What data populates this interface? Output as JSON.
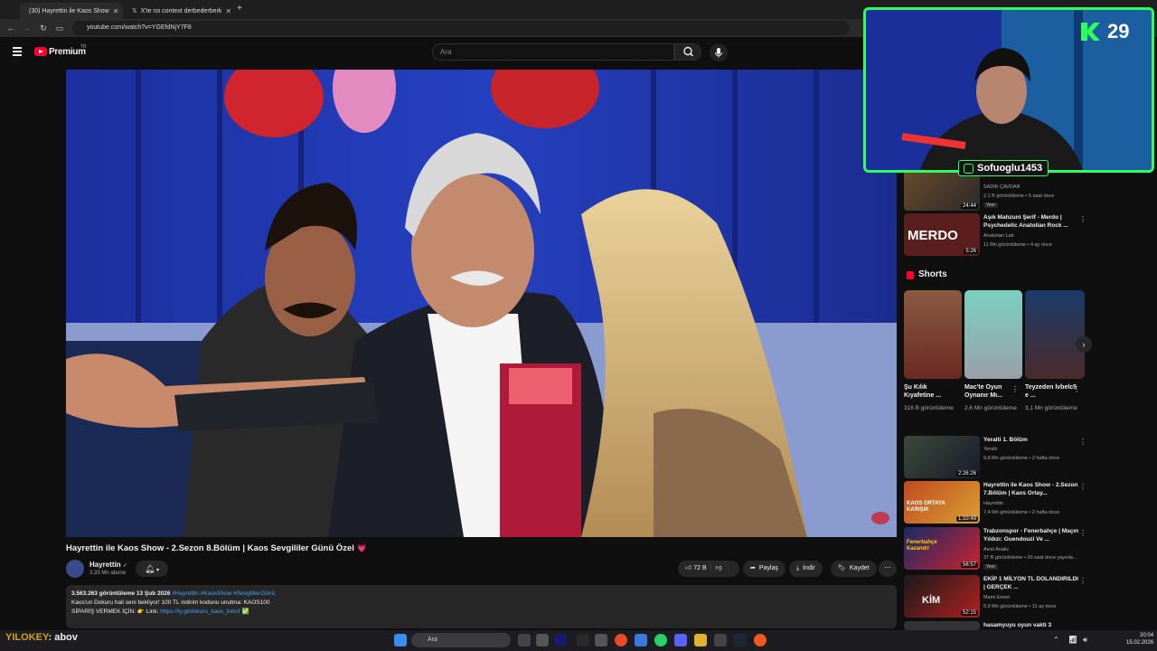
{
  "browser": {
    "tabs": [
      {
        "label": "(30) Hayrettin ile Kaos Show",
        "active": true
      },
      {
        "label": "X'te no context derbederberk",
        "active": false
      }
    ],
    "url": "youtube.com/watch?v=YGEfdNjY7F8"
  },
  "youtube": {
    "brand": "Premium",
    "brand_sup": "TR",
    "search_placeholder": "Ara"
  },
  "video": {
    "title": "Hayrettin ile Kaos Show - 2.Sezon 8.Bölüm | Kaos Sevgililer Günü Özel",
    "heart": "💗",
    "channel": "Hayrettin",
    "verified": "✓",
    "subscribers": "3,33 Mn abone",
    "likes": "72 B",
    "share": "Paylaş",
    "download": "İndir",
    "save": "Kaydet",
    "more": "⋯"
  },
  "description": {
    "views_date": "3.563.263 görüntüleme  13 Şub 2026",
    "tags": "#Hayrettin #KaosShow #SevgililerGünü",
    "line2": "Kaos'un Dokuru hali seni bekliyor! 100 TL indirim kodunu unutma: KAOS100",
    "line3_prefix": "SİPARİŞ VERMEK İÇİN: 👉 Link: ",
    "line3_link": "https://ty.gl/dokuru_kaos_kxkcf",
    "line3_suffix": " ✅"
  },
  "sidebar": {
    "top_recs": [
      {
        "title": "",
        "channel": "SADIK ÇAVDAR",
        "meta": "2,1 B görüntüleme • 5 saat önce",
        "badge": "Yeni",
        "duration": "24:44"
      },
      {
        "title": "Aşık Mahzuni Şerif - Merdo | Psychedelic Anatolian Rock ...",
        "channel": "Anatolian Lab",
        "meta": "11 Mn görüntüleme • 4 ay önce",
        "duration": "5:26",
        "thumb_text": "MERDO"
      }
    ],
    "shorts_title": "Shorts",
    "shorts": [
      {
        "title": "Şu Kılık Kıyafetine ...",
        "views": "316 B görüntüleme"
      },
      {
        "title": "Mac'te Oyun Oynanır Mı...",
        "views": "2,6 Mn görüntüleme"
      },
      {
        "title": "Teyzeden lvbelc5 e ...",
        "views": "3,1 Mn görüntüleme"
      }
    ],
    "recs": [
      {
        "title": "Yeralti 1. Bölüm",
        "channel": "Yeraltı",
        "meta": "9,8 Mn görüntüleme • 2 hafta önce",
        "duration": "2:26:26"
      },
      {
        "title": "Hayrettin ile Kaos Show - 2.Sezon 7.Bölüm | Kaos Ortay...",
        "channel": "Hayrettin",
        "meta": "7,4 Mn görüntüleme • 2 hafta önce",
        "duration": "1:10:49",
        "thumb_text": "KAOS ORTAYA KARIŞIK"
      },
      {
        "title": "Trabzonspor - Fenerbahçe | Maçın Yıldızı: Guendouzi Ve ...",
        "channel": "Asist Analiz",
        "meta": "37 B görüntüleme • 20 saat önce yayınla...",
        "badge": "Yeni",
        "duration": "56:57",
        "thumb_text": "Fenerbahçe Kazandı!"
      },
      {
        "title": "EKİP 1 MİLYON TL DOLANDIRILDI | GERÇEK ...",
        "channel": "Mami Emen",
        "meta": "5,9 Mn görüntüleme • 11 ay önce",
        "duration": "52:15",
        "thumb_text": "KİM"
      },
      {
        "title": "hasamyuyu oyun vakti 3",
        "channel": "",
        "meta": "",
        "duration": ""
      }
    ]
  },
  "overlay": {
    "cam_number": "29",
    "instagram_handle": "Sofuoglu1453",
    "chat_user": "YILOKEY",
    "chat_text": ": abov"
  },
  "taskbar": {
    "search_label": "Ara",
    "time": "20:04",
    "date": "15.02.2026"
  },
  "colors": {
    "accent_red": "#ff0033",
    "cam_border": "#2eff5e",
    "link": "#3ea6ff"
  }
}
